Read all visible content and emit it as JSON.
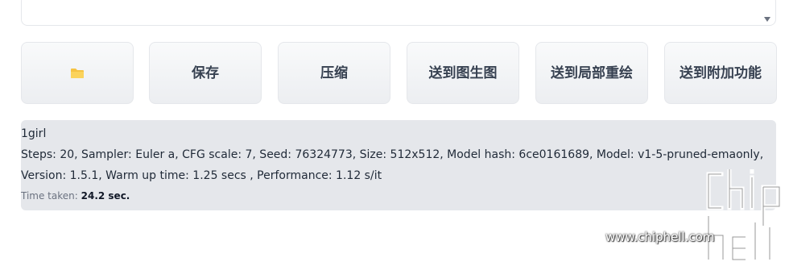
{
  "textarea": {
    "value": ""
  },
  "buttons": {
    "folder_label": "",
    "save_label": "保存",
    "zip_label": "压缩",
    "send_img2img_label": "送到图生图",
    "send_inpaint_label": "送到局部重绘",
    "send_extras_label": "送到附加功能"
  },
  "info": {
    "prompt": "1girl",
    "params": "Steps: 20, Sampler: Euler a, CFG scale: 7, Seed: 76324773, Size: 512x512, Model hash: 6ce0161689, Model: v1-5-pruned-emaonly, Version: 1.5.1, Warm up time: 1.25 secs , Performance: 1.12 s/it",
    "time_label": "Time taken:",
    "time_value": "24.2 sec."
  },
  "watermark": {
    "url": "www.chiphell.com",
    "logo_text": "chip hell"
  },
  "colors": {
    "folder": "#f6c343",
    "panel": "#e5e7eb",
    "button_text": "#374151"
  }
}
